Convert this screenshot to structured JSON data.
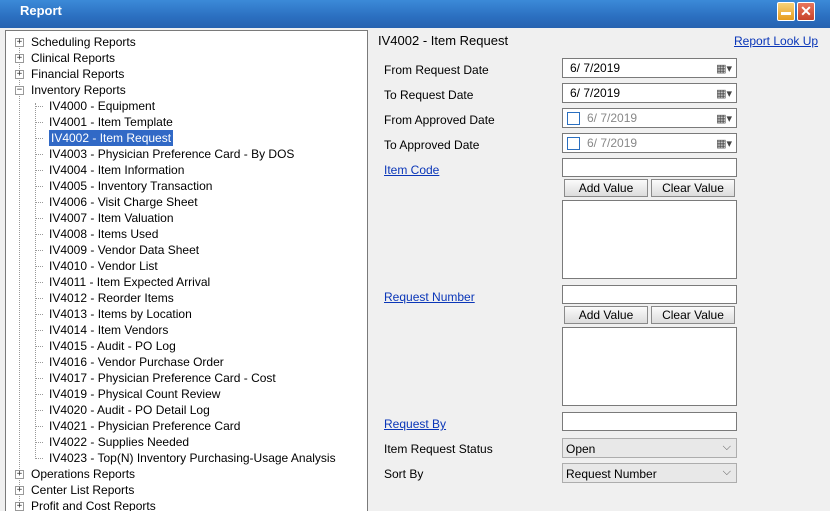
{
  "window": {
    "title": "Report"
  },
  "tree": {
    "categories_top": [
      "Scheduling Reports",
      "Clinical Reports",
      "Financial Reports",
      "Inventory Reports"
    ],
    "inventory_items": [
      "IV4000 - Equipment",
      "IV4001 - Item Template",
      "IV4002 - Item Request",
      "IV4003 - Physician Preference Card - By DOS",
      "IV4004 - Item Information",
      "IV4005 - Inventory Transaction",
      "IV4006 - Visit Charge Sheet",
      "IV4007 - Item Valuation",
      "IV4008 - Items Used",
      "IV4009 - Vendor Data Sheet",
      "IV4010 - Vendor List",
      "IV4011 - Item Expected Arrival",
      "IV4012 - Reorder Items",
      "IV4013 - Items by Location",
      "IV4014 - Item Vendors",
      "IV4015 - Audit - PO Log",
      "IV4016 - Vendor Purchase Order",
      "IV4017 - Physician Preference Card - Cost",
      "IV4019 - Physical Count Review",
      "IV4020 - Audit - PO Detail Log",
      "IV4021 - Physician Preference Card",
      "IV4022 - Supplies Needed",
      "IV4023 - Top(N) Inventory Purchasing-Usage Analysis"
    ],
    "categories_bottom": [
      "Operations Reports",
      "Center List Reports",
      "Profit and Cost Reports"
    ]
  },
  "form": {
    "report_title": "IV4002 - Item Request",
    "lookup_link": "Report Look Up",
    "from_request_date_label": "From Request Date",
    "from_request_date": "6/  7/2019",
    "to_request_date_label": "To Request Date",
    "to_request_date": "6/  7/2019",
    "from_approved_date_label": "From Approved Date",
    "from_approved_date": "6/  7/2019",
    "to_approved_date_label": "To Approved Date",
    "to_approved_date": "6/  7/2019",
    "item_code_label": "Item Code",
    "item_code_value": "",
    "add_value": "Add Value",
    "clear_value": "Clear Value",
    "request_number_label": "Request Number",
    "request_number_value": "",
    "request_by_label": "Request By",
    "request_by_value": "",
    "status_label": "Item Request Status",
    "status_value": "Open",
    "sort_label": "Sort By",
    "sort_value": "Request Number"
  },
  "icons": {
    "calendar": "calendar-icon",
    "dropdown": "chevron-down-icon",
    "minimize": "minimize-icon",
    "close": "close-icon"
  },
  "colors": {
    "titlebar": "#2b6fc0",
    "selection": "#3169c6",
    "link": "#0a36b8"
  }
}
